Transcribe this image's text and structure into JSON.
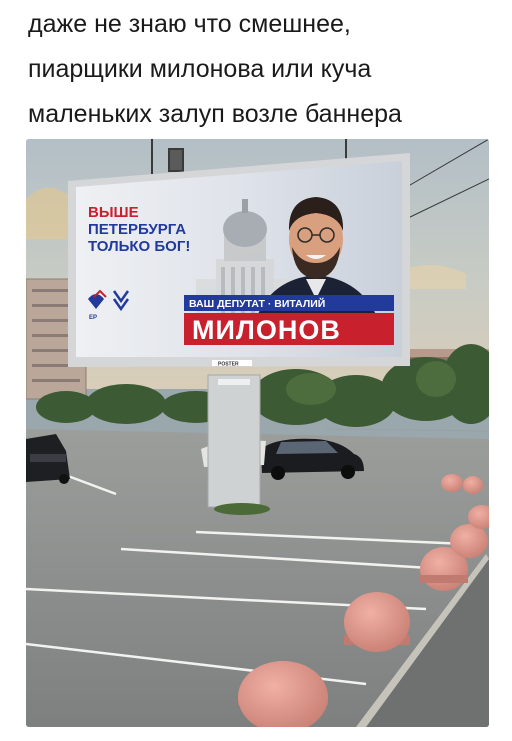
{
  "post": {
    "caption_lines": [
      "даже не знаю что смешнее,",
      "пиарщики милонова или куча",
      "маленьких залуп возле баннера"
    ]
  },
  "billboard": {
    "slogan_lines": [
      "ВЫШЕ",
      "ПЕТЕРБУРГА",
      "ТОЛЬКО БОГ!"
    ],
    "deputy_line": "ВАШ ДЕПУТАТ · ВИТАЛИЙ",
    "surname": "МИЛОНОВ",
    "party_logo_label": "ЕР",
    "frame_label": "POSTER"
  },
  "colors": {
    "banner_blue": "#223a9c",
    "banner_red": "#c8202c",
    "bollard": "#e0958a",
    "asphalt": "#8d8f8e"
  }
}
